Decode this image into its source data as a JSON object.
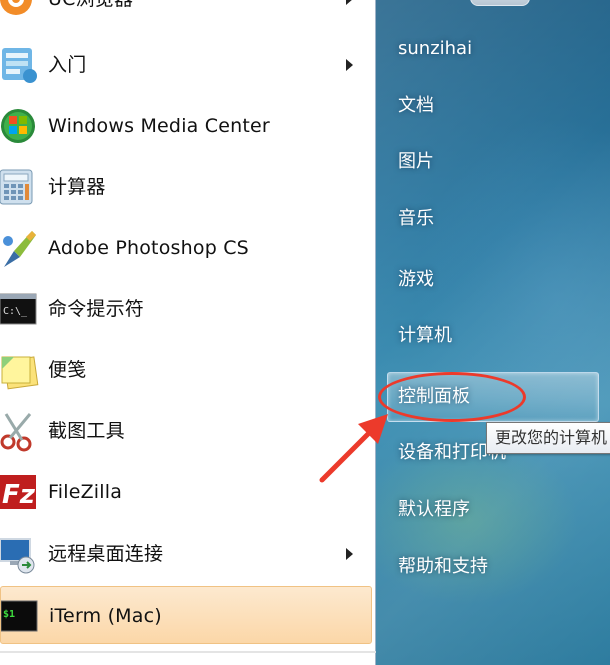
{
  "left_programs": [
    {
      "label": "UC浏览器",
      "icon": "uc-browser-icon",
      "submenu": true
    },
    {
      "label": "入门",
      "icon": "getting-started-icon",
      "submenu": true
    },
    {
      "label": "Windows Media Center",
      "icon": "windows-media-center-icon",
      "submenu": false
    },
    {
      "label": "计算器",
      "icon": "calculator-icon",
      "submenu": false
    },
    {
      "label": "Adobe Photoshop CS",
      "icon": "photoshop-icon",
      "submenu": false
    },
    {
      "label": "命令提示符",
      "icon": "command-prompt-icon",
      "submenu": false
    },
    {
      "label": "便笺",
      "icon": "sticky-notes-icon",
      "submenu": false
    },
    {
      "label": "截图工具",
      "icon": "snipping-tool-icon",
      "submenu": false
    },
    {
      "label": "FileZilla",
      "icon": "filezilla-icon",
      "submenu": false
    },
    {
      "label": "远程桌面连接",
      "icon": "remote-desktop-icon",
      "submenu": true
    },
    {
      "label": "iTerm (Mac)",
      "icon": "iterm-icon",
      "submenu": false,
      "highlighted": true
    }
  ],
  "right_items": [
    {
      "label": "sunzihai"
    },
    {
      "label": "文档"
    },
    {
      "label": "图片"
    },
    {
      "label": "音乐"
    },
    {
      "label": "游戏"
    },
    {
      "label": "计算机"
    },
    {
      "label": "控制面板",
      "highlighted": true
    },
    {
      "label": "设备和打印机"
    },
    {
      "label": "默认程序"
    },
    {
      "label": "帮助和支持"
    }
  ],
  "tooltip": "更改您的计算机",
  "cmd_icon_text": "C:\\_",
  "filezilla_icon_text": "Fz",
  "iterm_icon_text": "$1",
  "colors": {
    "annotation_red": "#ec3a2b",
    "right_pane": "#2b79a2",
    "highlight": "#fbd7a8"
  }
}
